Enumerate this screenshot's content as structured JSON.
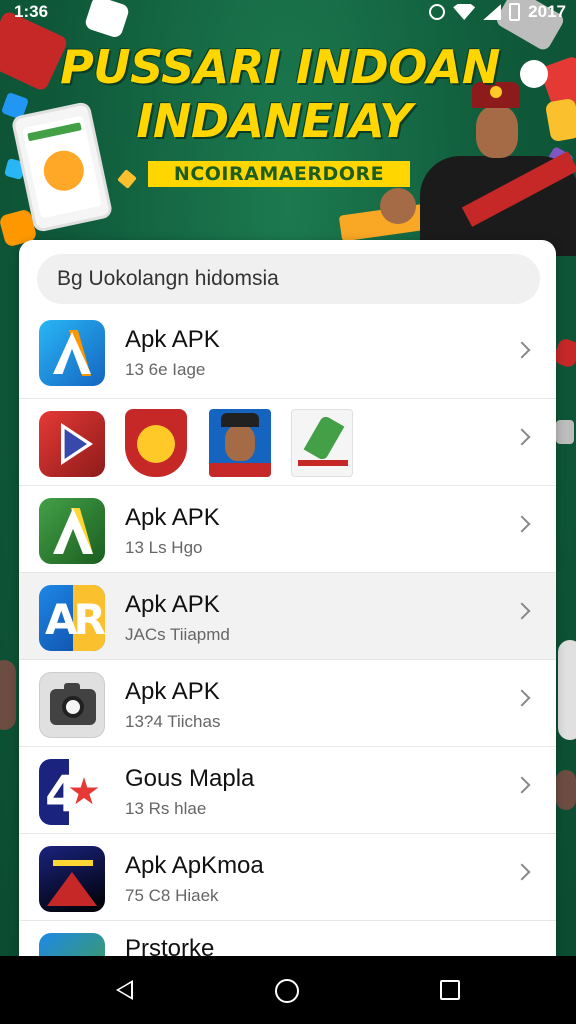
{
  "status_bar": {
    "time": "1:36",
    "right_text": "2017"
  },
  "banner": {
    "title_line1": "PUSSARI INDOAN",
    "title_line2": "INDANEIAY",
    "subtitle": "NCOIRAMAERDORE"
  },
  "search": {
    "placeholder": "Bg Uokolangn hidomsia"
  },
  "list": [
    {
      "title": "Apk APK",
      "subtitle": "13 6e Iage",
      "icon": "apk-blue-a-icon"
    },
    {
      "title": "",
      "subtitle": "",
      "icon": "apk-red-play-icon",
      "thumbnails": [
        "emblem-thumbnail",
        "soldier-portrait-thumbnail",
        "green-leaf-logo-thumbnail"
      ]
    },
    {
      "title": "Apk APK",
      "subtitle": "13 Ls Hgo",
      "icon": "apk-green-a-icon"
    },
    {
      "title": "Apk APK",
      "subtitle": "JACs Tiiapmd",
      "icon": "apk-ar-icon"
    },
    {
      "title": "Apk APK",
      "subtitle": "13?4 Tiichas",
      "icon": "camera-icon"
    },
    {
      "title": "Gous Mapla",
      "subtitle": "13 Rs hlae",
      "icon": "four-star-icon"
    },
    {
      "title": "Apk ApKmoa",
      "subtitle": "75 C8 Hiaek",
      "icon": "red-triangle-icon"
    },
    {
      "title": "Prstorke",
      "subtitle": "",
      "icon": "play-store-icon"
    }
  ],
  "colors": {
    "background_green": "#0f5a3a",
    "banner_yellow": "#ffd600",
    "card_white": "#ffffff",
    "highlight_row": "#f2f2f2"
  }
}
